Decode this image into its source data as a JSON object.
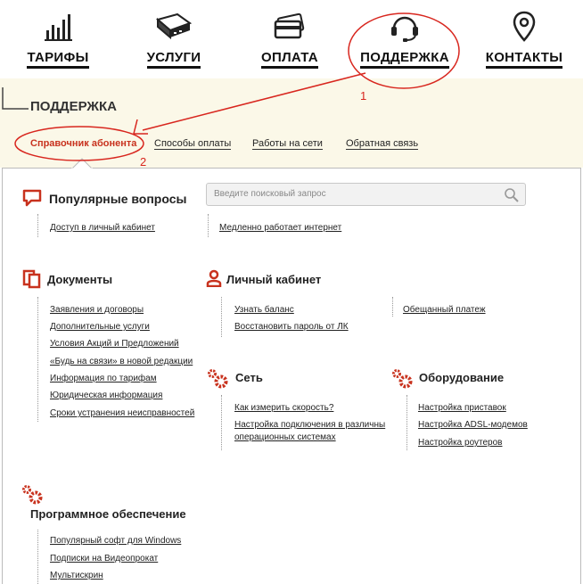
{
  "nav": [
    {
      "label": "ТАРИФЫ",
      "icon": "bar-chart-icon"
    },
    {
      "label": "УСЛУГИ",
      "icon": "router-device-icon"
    },
    {
      "label": "ОПЛАТА",
      "icon": "credit-card-icon"
    },
    {
      "label": "ПОДДЕРЖКА",
      "icon": "headset-icon"
    },
    {
      "label": "КОНТАКТЫ",
      "icon": "location-pin-icon"
    }
  ],
  "page_title": "ПОДДЕРЖКА",
  "subnav": [
    {
      "label": "Справочник абонента",
      "active": true
    },
    {
      "label": "Способы оплаты"
    },
    {
      "label": "Работы на сети"
    },
    {
      "label": "Обратная связь"
    }
  ],
  "search": {
    "placeholder": "Введите поисковый запрос",
    "icon": "search-icon"
  },
  "sections": {
    "faq": {
      "title": "Популярные вопросы",
      "icon": "speech-bubble-icon",
      "links": [
        "Доступ в личный кабинет",
        "Медленно работает интернет"
      ]
    },
    "docs": {
      "title": "Документы",
      "icon": "documents-icon",
      "links": [
        "Заявления и договоры",
        "Дополнительные услуги",
        "Условия Акций и Предложений",
        "«Будь на связи» в новой редакции",
        "Информация по тарифам",
        "Юридическая информация",
        "Сроки устранения неисправностей"
      ]
    },
    "account": {
      "title": "Личный кабинет",
      "icon": "user-icon",
      "links": [
        "Узнать баланс",
        "Восстановить пароль от ЛК",
        "Обещанный платеж"
      ]
    },
    "network": {
      "title": "Сеть",
      "icon": "gears-icon",
      "links": [
        "Как измерить скорость?",
        "Настройка подключения в различны",
        "операционных системах"
      ]
    },
    "equipment": {
      "title": "Оборудование",
      "icon": "gears-icon",
      "links": [
        "Настройка приставок",
        "Настройка ADSL-модемов",
        "Настройка роутеров"
      ]
    },
    "software": {
      "title": "Программное обеспечение",
      "icon": "gears-icon",
      "links": [
        "Популярный софт для Windows",
        "Подписки на Видеопрокат",
        "Мультискрин"
      ]
    }
  },
  "annotations": {
    "one": "1",
    "two": "2"
  },
  "colors": {
    "accent": "#c8321e",
    "annotation": "#d8261e",
    "band": "#fbf8e8"
  }
}
